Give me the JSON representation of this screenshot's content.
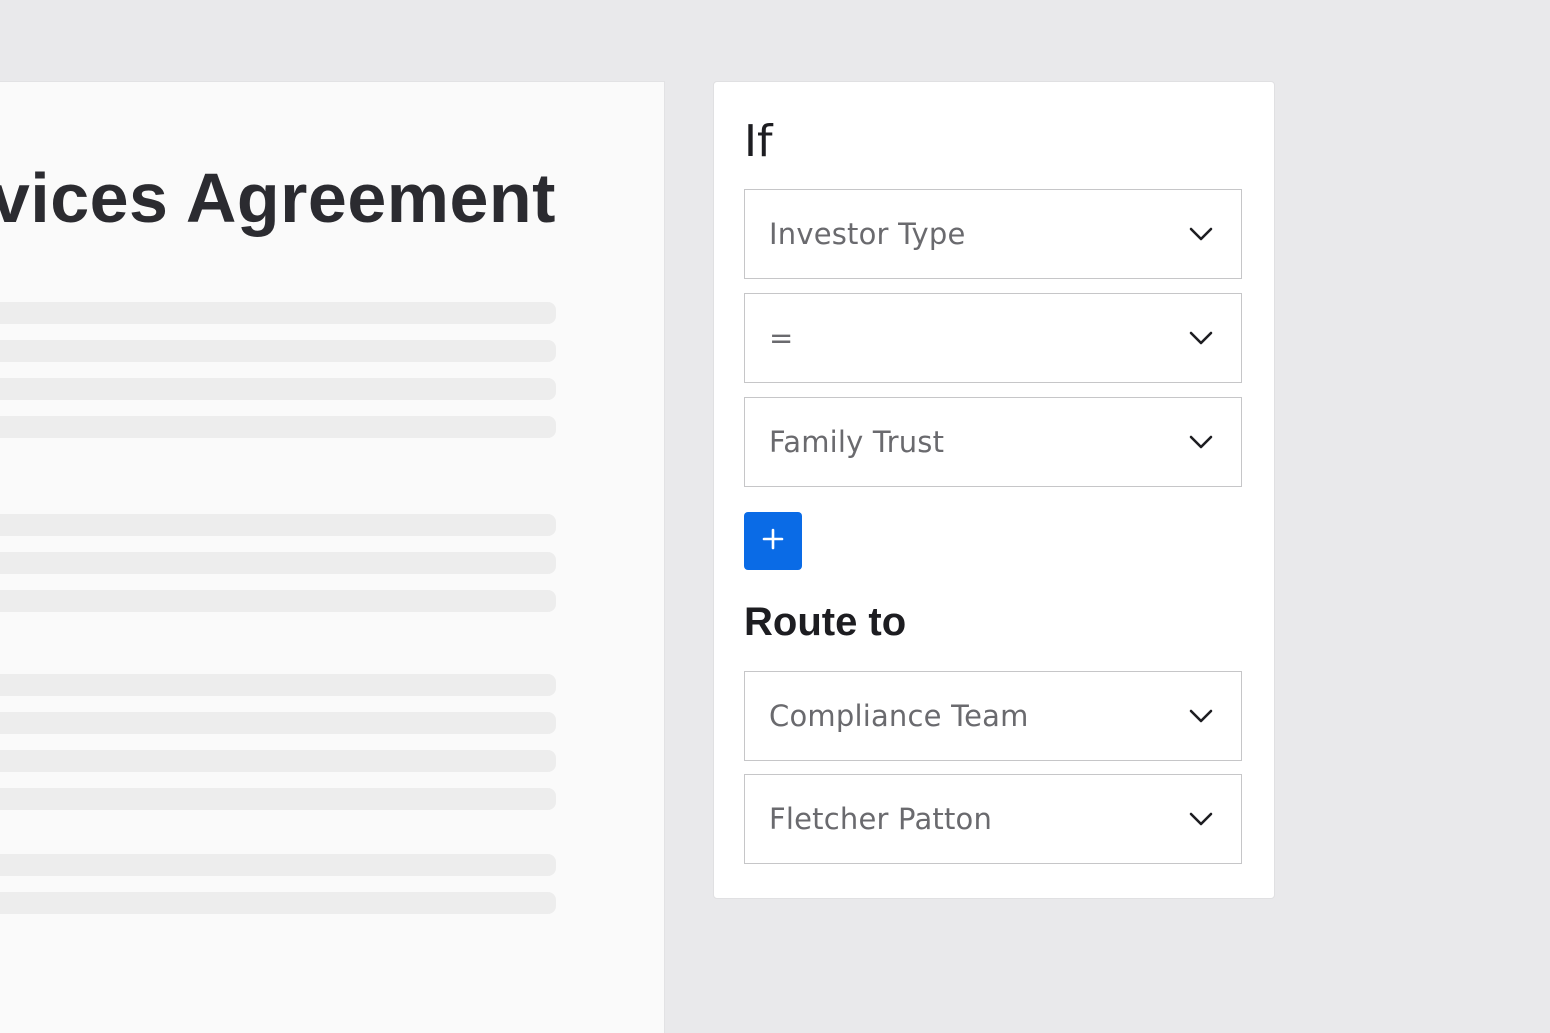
{
  "document": {
    "title": "rvices Agreement"
  },
  "panel": {
    "if_heading": "If",
    "conditions": [
      {
        "value": "Investor Type"
      },
      {
        "value": "="
      },
      {
        "value": "Family Trust"
      }
    ],
    "add_button_label": "+",
    "route_heading": "Route to",
    "routes": [
      {
        "value": "Compliance Team"
      },
      {
        "value": "Fletcher Patton"
      }
    ]
  },
  "icons": {
    "chevron": "chevron-down-icon",
    "add": "plus-icon"
  },
  "colors": {
    "accent": "#0a6be6",
    "background": "#e9e9eb",
    "document": "#fafafa",
    "panel": "#ffffff"
  }
}
